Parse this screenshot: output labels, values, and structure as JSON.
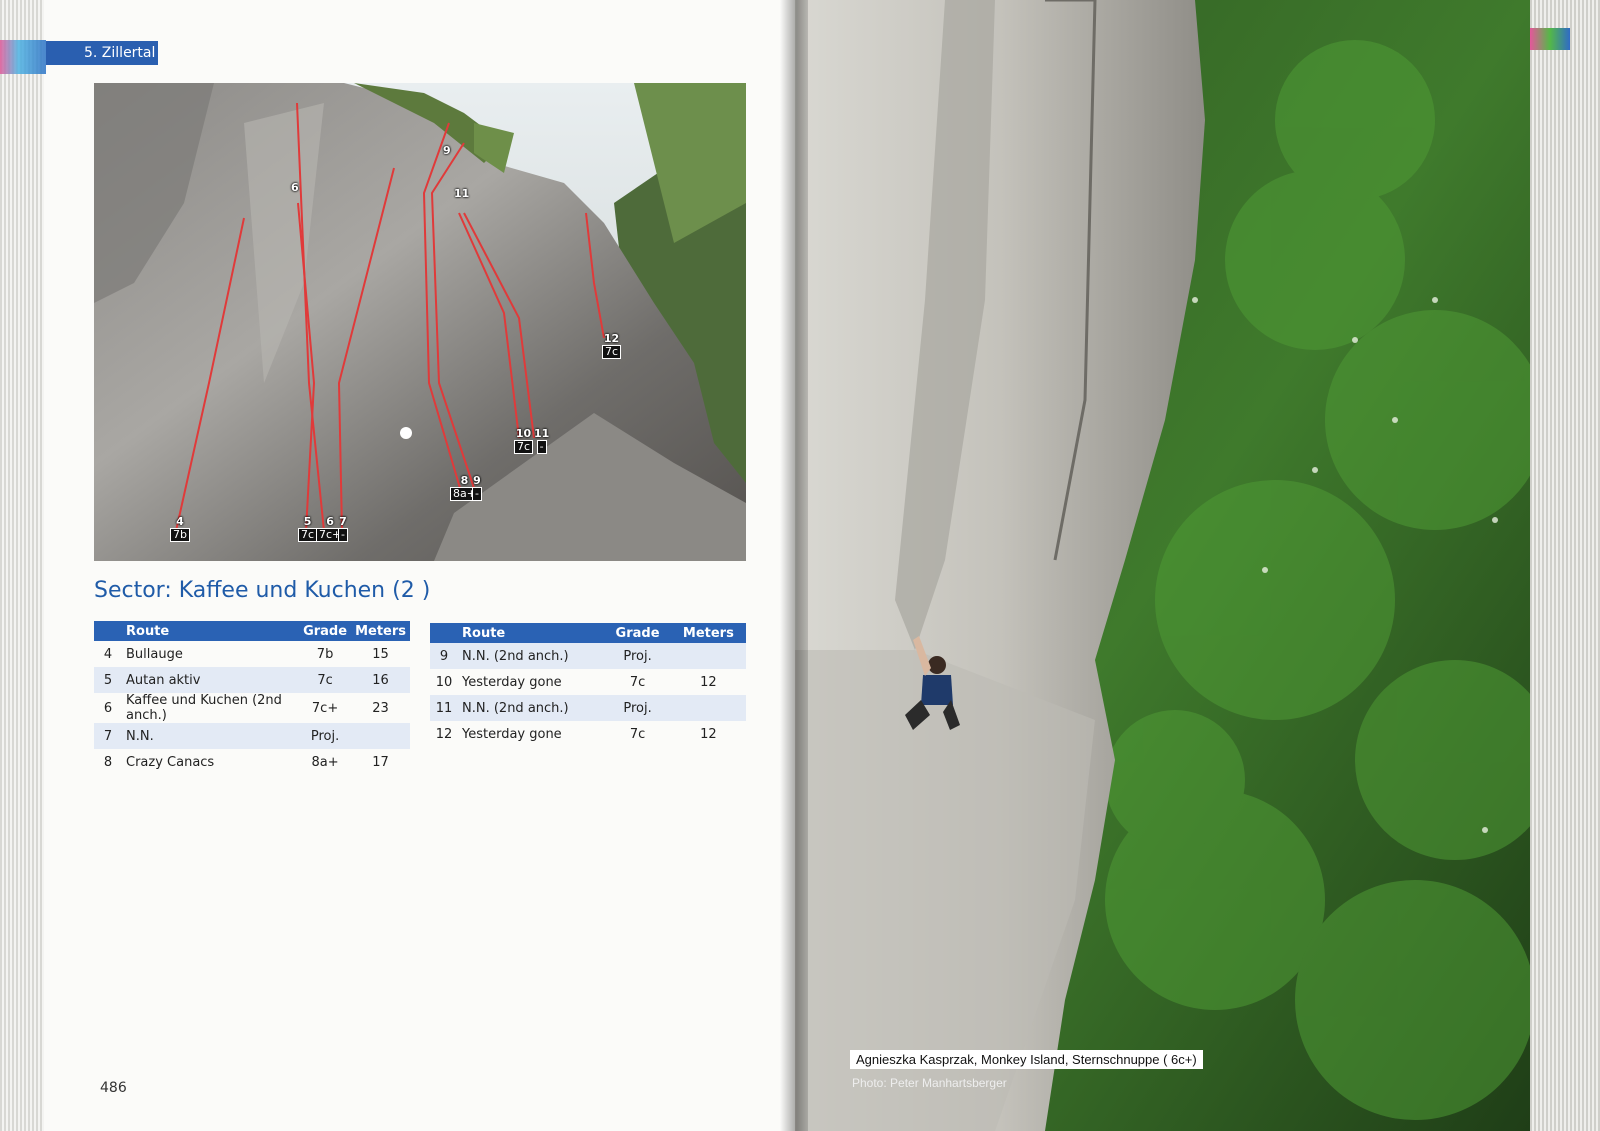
{
  "left_page": {
    "chapter": "5. Zillertal",
    "sector_title": "Sector: Kaffee und Kuchen (2 )",
    "page_number": "486",
    "topo_markers": [
      {
        "num": "4",
        "grade": "7b"
      },
      {
        "num": "5",
        "grade": "7c"
      },
      {
        "num": "6",
        "grade": "7c+"
      },
      {
        "num": "7",
        "grade": "-"
      },
      {
        "num": "8",
        "grade": "8a+"
      },
      {
        "num": "9",
        "grade": "-"
      },
      {
        "num": "10",
        "grade": "7c"
      },
      {
        "num": "11",
        "grade": "-"
      },
      {
        "num": "12",
        "grade": "7c"
      },
      {
        "num": "6",
        "grade": ""
      },
      {
        "num": "9",
        "grade": ""
      },
      {
        "num": "11",
        "grade": ""
      }
    ],
    "table_headers": {
      "route": "Route",
      "grade": "Grade",
      "meters": "Meters"
    },
    "table1": [
      {
        "no": "4",
        "route": "Bullauge",
        "grade": "7b",
        "meters": "15"
      },
      {
        "no": "5",
        "route": "Autan aktiv",
        "grade": "7c",
        "meters": "16"
      },
      {
        "no": "6",
        "route": "Kaffee und Kuchen (2nd anch.)",
        "grade": "7c+",
        "meters": "23"
      },
      {
        "no": "7",
        "route": "N.N.",
        "grade": "Proj.",
        "meters": ""
      },
      {
        "no": "8",
        "route": "Crazy Canacs",
        "grade": "8a+",
        "meters": "17"
      }
    ],
    "table2": [
      {
        "no": "9",
        "route": "N.N. (2nd anch.)",
        "grade": "Proj.",
        "meters": ""
      },
      {
        "no": "10",
        "route": "Yesterday gone",
        "grade": "7c",
        "meters": "12"
      },
      {
        "no": "11",
        "route": "N.N. (2nd anch.)",
        "grade": "Proj.",
        "meters": ""
      },
      {
        "no": "12",
        "route": "Yesterday gone",
        "grade": "7c",
        "meters": "12"
      }
    ]
  },
  "right_page": {
    "caption": "Agnieszka Kasprzak, Monkey Island, Sternschnuppe ( 6c+)",
    "credit": "Photo: Peter Manhartsberger"
  },
  "colors": {
    "accent": "#2a62b4",
    "route_line": "#e03a3a"
  }
}
